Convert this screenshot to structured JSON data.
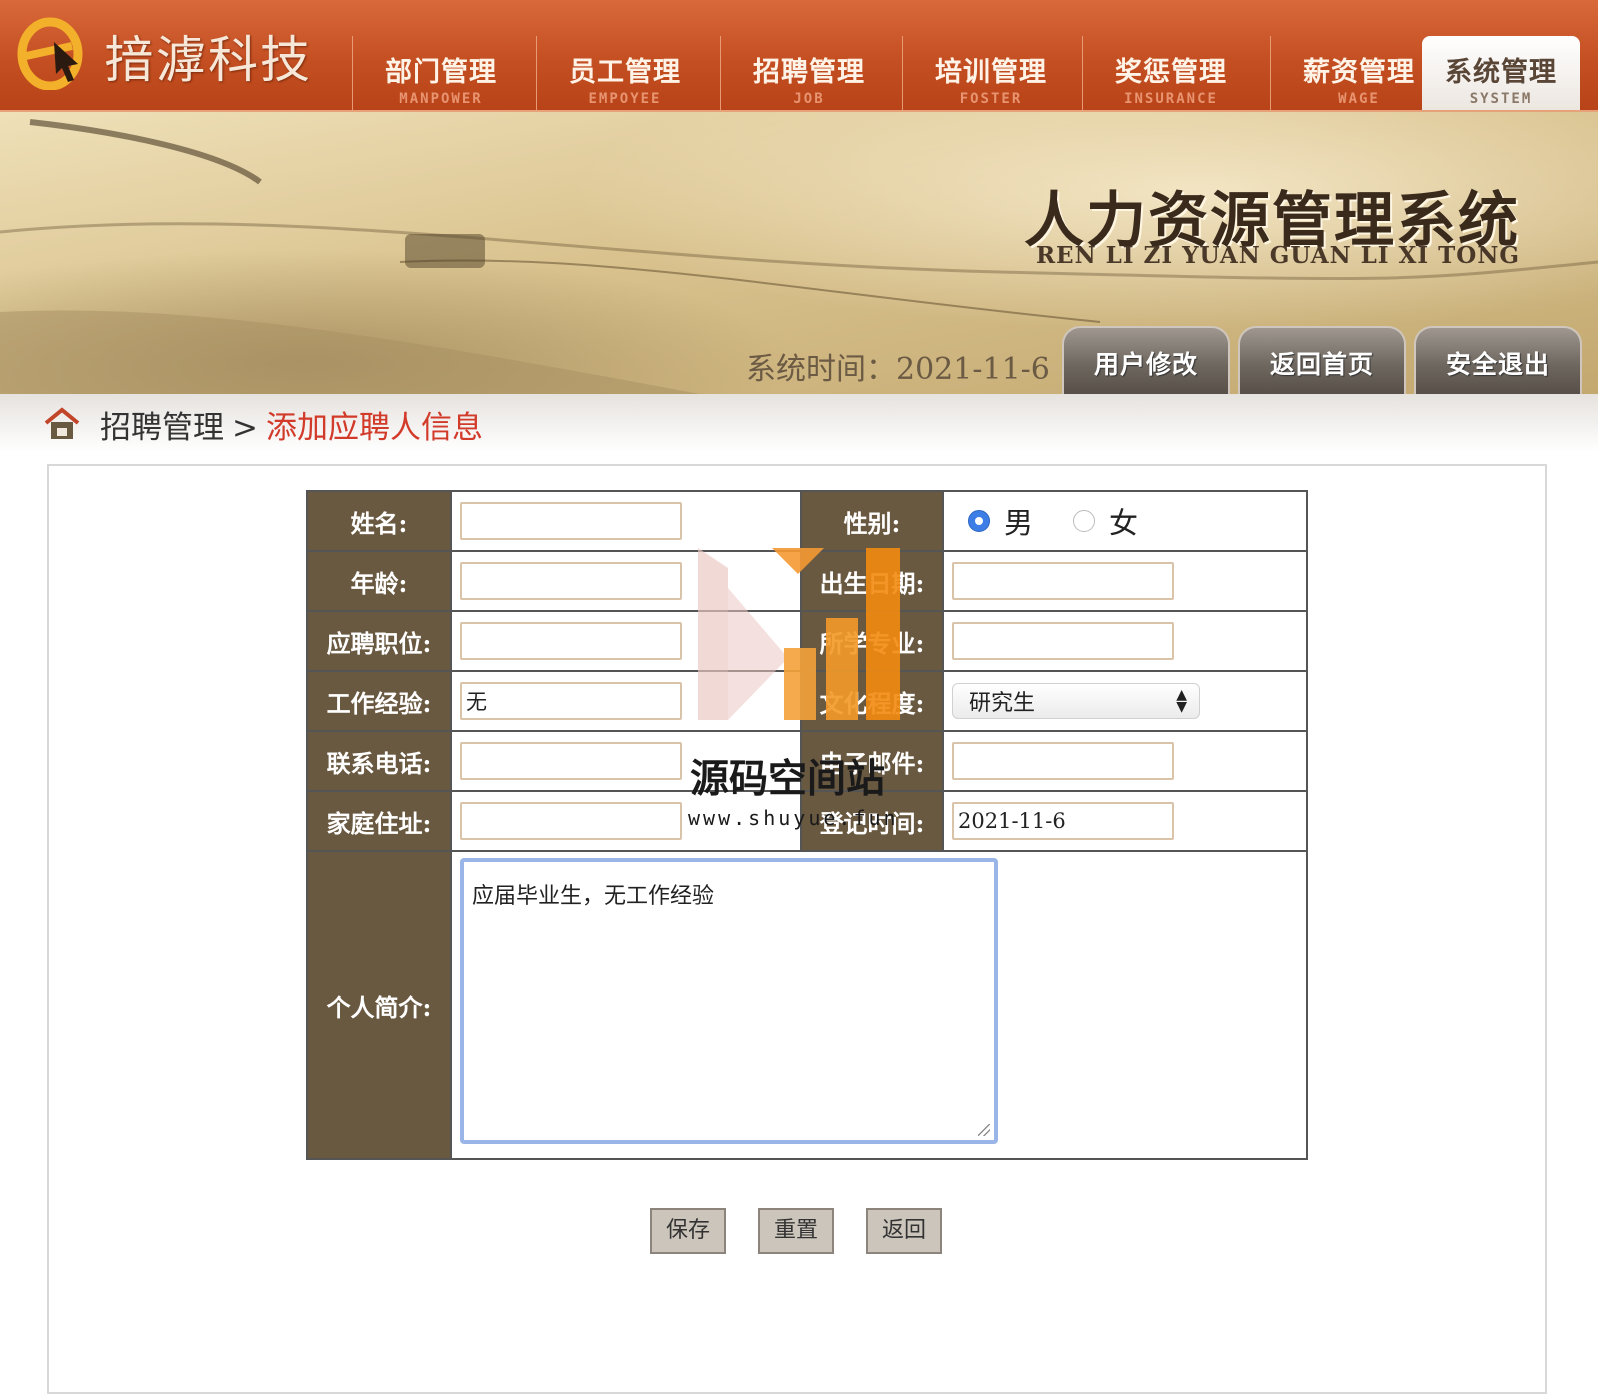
{
  "header": {
    "company_name": "揞滹科技",
    "colors": {
      "bar": "#c44f22",
      "label_bg": "#6a5941",
      "accent_red": "#d23a2a"
    },
    "nav": [
      {
        "cn": "部门管理",
        "en": "MANPOWER",
        "active": false
      },
      {
        "cn": "员工管理",
        "en": "EMPOYEE",
        "active": false
      },
      {
        "cn": "招聘管理",
        "en": "JOB",
        "active": false
      },
      {
        "cn": "培训管理",
        "en": "FOSTER",
        "active": false
      },
      {
        "cn": "奖惩管理",
        "en": "INSURANCE",
        "active": false
      },
      {
        "cn": "薪资管理",
        "en": "WAGE",
        "active": false
      },
      {
        "cn": "系统管理",
        "en": "SYSTEM",
        "active": true
      }
    ]
  },
  "banner": {
    "title": "人力资源管理系统",
    "subtitle": "REN LI ZI YUAN GUAN LI XI TONG",
    "system_time_label": "系统时间：",
    "system_time": "2021-11-6",
    "buttons": [
      "用户修改",
      "返回首页",
      "安全退出"
    ]
  },
  "breadcrumb": {
    "icon": "home-icon",
    "parent": "招聘管理",
    "separator": ">",
    "current": "添加应聘人信息"
  },
  "form": {
    "name_label": "姓名:",
    "name_value": "",
    "gender_label": "性别:",
    "gender_options": [
      "男",
      "女"
    ],
    "gender_selected": "男",
    "age_label": "年龄:",
    "age_value": "",
    "birth_label": "出生日期:",
    "birth_value": "",
    "position_label": "应聘职位:",
    "position_value": "",
    "major_label": "所学专业:",
    "major_value": "",
    "experience_label": "工作经验:",
    "experience_value": "无",
    "education_label": "文化程度:",
    "education_value": "研究生",
    "phone_label": "联系电话:",
    "phone_value": "",
    "email_label": "电子邮件:",
    "email_value": "",
    "address_label": "家庭住址:",
    "address_value": "",
    "register_label": "登记时间:",
    "register_value": "2021-11-6",
    "intro_label": "个人简介:",
    "intro_value": "应届毕业生，无工作经验"
  },
  "actions": {
    "save": "保存",
    "reset": "重置",
    "back": "返回"
  },
  "watermark": {
    "text": "源码空间站",
    "url": "www.shuyue.fun"
  }
}
